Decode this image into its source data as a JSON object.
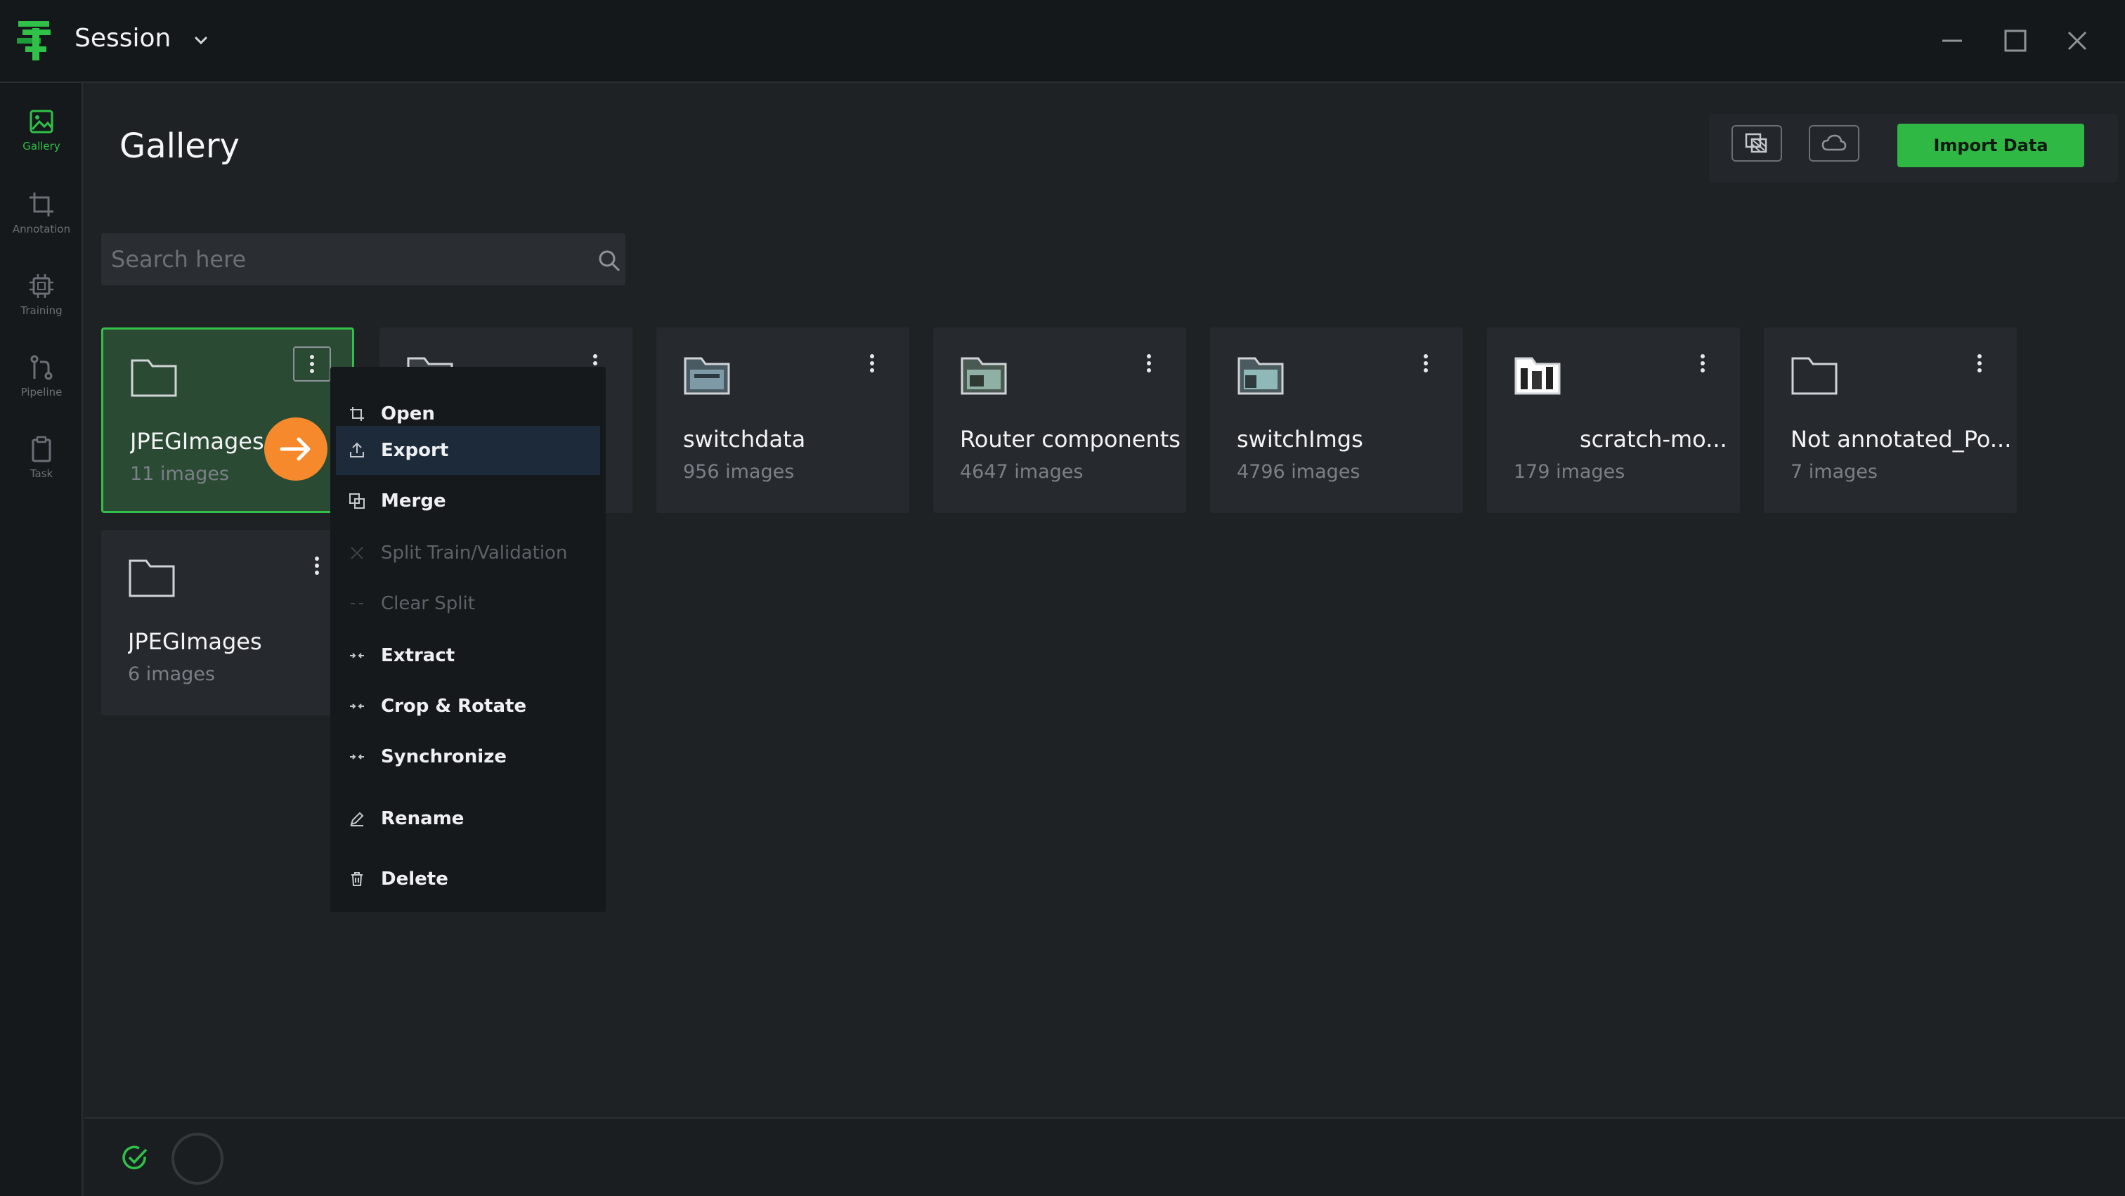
{
  "window": {
    "title": "Session"
  },
  "rail": {
    "items": [
      {
        "label": "Gallery",
        "icon": "gallery-icon",
        "active": true
      },
      {
        "label": "Annotation",
        "icon": "crop-icon",
        "active": false
      },
      {
        "label": "Training",
        "icon": "chip-icon",
        "active": false
      },
      {
        "label": "Pipeline",
        "icon": "pipeline-icon",
        "active": false
      },
      {
        "label": "Task",
        "icon": "clipboard-icon",
        "active": false
      }
    ]
  },
  "page": {
    "title": "Gallery"
  },
  "toolbar": {
    "import_label": "Import Data"
  },
  "search": {
    "placeholder": "Search here",
    "value": ""
  },
  "datasets": [
    {
      "name": "JPEGImages",
      "count": "11 images",
      "selected": true
    },
    {
      "name": "",
      "count": "",
      "selected": false
    },
    {
      "name": "switchdata",
      "count": "956 images",
      "selected": false
    },
    {
      "name": "Router components",
      "count": "4647 images",
      "selected": false
    },
    {
      "name": "switchImgs",
      "count": "4796 images",
      "selected": false
    },
    {
      "name": "scratch-mo...",
      "count": "179 images",
      "selected": false
    },
    {
      "name": "Not annotated_Po...",
      "count": "7 images",
      "selected": false
    },
    {
      "name": "JPEGImages",
      "count": "6 images",
      "selected": false
    }
  ],
  "context_menu": {
    "items": [
      {
        "label": "Open",
        "icon": "open-icon",
        "disabled": false
      },
      {
        "label": "Export",
        "icon": "export-icon",
        "disabled": false,
        "highlighted": true
      },
      {
        "label": "Merge",
        "icon": "merge-icon",
        "disabled": false
      },
      {
        "label": "Split Train/Validation",
        "icon": "split-icon",
        "disabled": true
      },
      {
        "label": "Clear Split",
        "icon": "clear-split-icon",
        "disabled": true
      },
      {
        "label": "Extract",
        "icon": "extract-icon",
        "disabled": false
      },
      {
        "label": "Crop & Rotate",
        "icon": "crop-rotate-icon",
        "disabled": false
      },
      {
        "label": "Synchronize",
        "icon": "sync-icon",
        "disabled": false
      },
      {
        "label": "Rename",
        "icon": "pencil-icon",
        "disabled": false
      },
      {
        "label": "Delete",
        "icon": "trash-icon",
        "disabled": false
      }
    ]
  },
  "colors": {
    "accent": "#2fb844",
    "selected_card": "#2b4a34",
    "drag_indicator": "#f5892b"
  }
}
